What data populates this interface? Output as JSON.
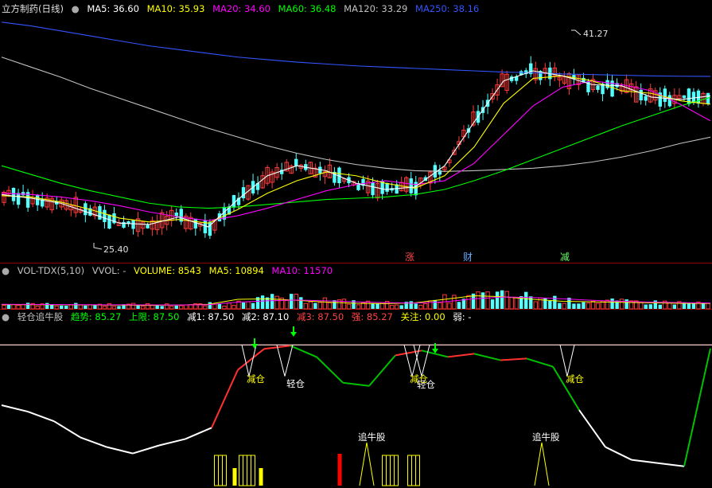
{
  "main_panel": {
    "title": "立方制药(日线)",
    "legend": [
      {
        "label": "MA5: 36.60",
        "color": "#ffffff"
      },
      {
        "label": "MA10: 35.93",
        "color": "#ffff00"
      },
      {
        "label": "MA20: 34.60",
        "color": "#ff00ff"
      },
      {
        "label": "MA60: 36.48",
        "color": "#00ff00"
      },
      {
        "label": "MA120: 33.29",
        "color": "#c0c0c0"
      },
      {
        "label": "MA250: 38.16",
        "color": "#3355ff"
      }
    ],
    "high_label": "41.27",
    "low_label": "25.40",
    "markers": [
      {
        "label": "涨",
        "color": "#ff4444"
      },
      {
        "label": "财",
        "color": "#66aaff"
      },
      {
        "label": "减",
        "color": "#66ff66"
      }
    ]
  },
  "volume_panel": {
    "legend": [
      {
        "label": "VOL-TDX(5,10)",
        "color": "#c0c0c0"
      },
      {
        "label": "VVOL: -",
        "color": "#c0c0c0"
      },
      {
        "label": "VOLUME: 8543",
        "color": "#ffff00"
      },
      {
        "label": "MA5: 10894",
        "color": "#ffff00"
      },
      {
        "label": "MA10: 11570",
        "color": "#ff00ff"
      }
    ]
  },
  "indicator_panel": {
    "legend": [
      {
        "label": "轻仓追牛股",
        "color": "#c0c0c0"
      },
      {
        "label": "趋势: 85.27",
        "color": "#00ff00"
      },
      {
        "label": "上限: 87.50",
        "color": "#00ff00"
      },
      {
        "label": "减1: 87.50",
        "color": "#ffffff"
      },
      {
        "label": "减2: 87.10",
        "color": "#ffffff"
      },
      {
        "label": "减3: 87.50",
        "color": "#ff4444"
      },
      {
        "label": "强: 85.27",
        "color": "#ff4444"
      },
      {
        "label": "关注: 0.00",
        "color": "#ffff00"
      },
      {
        "label": "弱: -",
        "color": "#ffffff"
      }
    ],
    "signals": [
      {
        "label": "减仓",
        "color": "#ffff00"
      },
      {
        "label": "轻仓",
        "color": "#ffffff"
      },
      {
        "label": "减仓",
        "color": "#ffff00"
      },
      {
        "label": "轻仓",
        "color": "#ffffff"
      },
      {
        "label": "减仓",
        "color": "#ffff00"
      }
    ],
    "spikes": [
      {
        "label": "追牛股"
      },
      {
        "label": "追牛股"
      }
    ]
  },
  "chart_data": {
    "type": "line",
    "title": "立方制药(日线)",
    "y_range_price": [
      24,
      43
    ],
    "series": [
      {
        "name": "MA250",
        "values": [
          42.5,
          42.2,
          41.8,
          41.4,
          41.0,
          40.6,
          40.3,
          40.0,
          39.7,
          39.5,
          39.3,
          39.15,
          39.0,
          38.9,
          38.8,
          38.7,
          38.6,
          38.5,
          38.45,
          38.35,
          38.3,
          38.25,
          38.2,
          38.17,
          38.16
        ]
      },
      {
        "name": "MA120",
        "values": [
          39.7,
          38.9,
          38.1,
          37.2,
          36.4,
          35.6,
          34.8,
          34.0,
          33.3,
          32.6,
          32.0,
          31.5,
          31.1,
          30.8,
          30.6,
          30.55,
          30.6,
          30.7,
          30.8,
          31.0,
          31.3,
          31.7,
          32.2,
          32.8,
          33.29
        ]
      },
      {
        "name": "MA60",
        "values": [
          31.0,
          30.3,
          29.6,
          29.0,
          28.5,
          28.0,
          27.7,
          27.6,
          27.7,
          27.9,
          28.1,
          28.3,
          28.4,
          28.5,
          28.7,
          29.1,
          29.8,
          30.6,
          31.5,
          32.4,
          33.3,
          34.2,
          35.0,
          35.8,
          36.48
        ]
      },
      {
        "name": "MA20",
        "values": [
          28.8,
          28.7,
          28.5,
          28.2,
          27.8,
          27.3,
          26.9,
          26.6,
          27.0,
          27.6,
          28.3,
          29.0,
          29.5,
          29.8,
          29.5,
          29.8,
          31.2,
          33.5,
          35.8,
          37.3,
          37.8,
          37.5,
          37.0,
          35.9,
          34.6
        ]
      },
      {
        "name": "MA10",
        "values": [
          28.6,
          28.5,
          28.1,
          27.5,
          26.8,
          26.5,
          26.7,
          26.4,
          27.5,
          28.8,
          29.8,
          30.5,
          30.2,
          29.6,
          29.2,
          30.2,
          32.5,
          36.0,
          38.0,
          38.2,
          37.8,
          37.0,
          36.8,
          36.2,
          35.93
        ]
      },
      {
        "name": "MA5",
        "values": [
          28.7,
          28.4,
          28.0,
          27.2,
          26.4,
          26.3,
          26.9,
          26.1,
          28.3,
          30.2,
          31.0,
          30.6,
          29.6,
          29.1,
          29.3,
          31.0,
          34.5,
          37.8,
          38.6,
          38.2,
          37.5,
          37.4,
          36.5,
          36.3,
          36.6
        ]
      }
    ],
    "volume": {
      "y_range": [
        0,
        60000
      ],
      "series": [
        {
          "name": "MA5",
          "values": [
            8500,
            8200,
            8000,
            7800,
            7500,
            7200,
            7600,
            9000,
            19000,
            20000,
            17000,
            13500,
            11000,
            10500,
            12000,
            19000,
            26000,
            24000,
            19000,
            15000,
            14000,
            13000,
            12000,
            11000,
            10894
          ]
        },
        {
          "name": "MA10",
          "values": [
            9000,
            8800,
            8500,
            8200,
            8000,
            7800,
            7700,
            8200,
            13500,
            16000,
            17500,
            16000,
            14000,
            12500,
            11500,
            14000,
            20000,
            23500,
            22500,
            20000,
            17000,
            15000,
            13500,
            12500,
            11570
          ]
        }
      ]
    },
    "indicator": {
      "y_range": [
        0,
        100
      ],
      "upper_limit": 87.5,
      "series": [
        {
          "name": "趋势",
          "values": [
            50,
            46,
            40,
            30,
            24,
            20,
            25,
            29,
            36,
            72,
            85,
            87,
            80,
            64,
            62,
            81,
            84,
            80,
            82,
            78,
            79,
            74,
            47,
            24,
            16,
            14,
            12,
            85.27
          ]
        }
      ]
    }
  }
}
